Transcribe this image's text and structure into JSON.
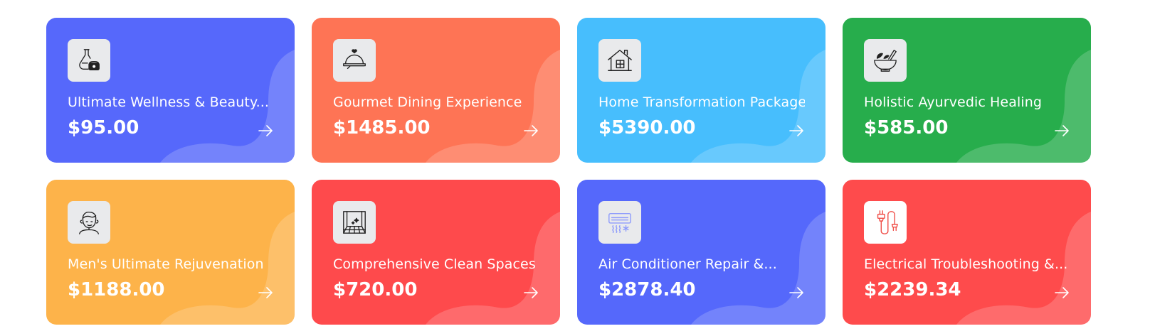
{
  "cards": [
    {
      "title": "Ultimate Wellness & Beauty...",
      "price": "$95.00",
      "color": "#5668fb",
      "icon": "spa-flask-icon"
    },
    {
      "title": "Gourmet Dining Experience",
      "price": "$1485.00",
      "color": "#fe7455",
      "icon": "serving-cloche-icon"
    },
    {
      "title": "Home Transformation Package",
      "price": "$5390.00",
      "color": "#47befd",
      "icon": "house-icon"
    },
    {
      "title": "Holistic Ayurvedic Healing",
      "price": "$585.00",
      "color": "#27ad4c",
      "icon": "mortar-pestle-icon"
    },
    {
      "title": "Men's Ultimate Rejuvenation",
      "price": "$1188.00",
      "color": "#fdb34a",
      "icon": "man-face-icon"
    },
    {
      "title": "Comprehensive Clean Spaces",
      "price": "$720.00",
      "color": "#fe4a4c",
      "icon": "clean-floor-icon"
    },
    {
      "title": "Air Conditioner Repair &...",
      "price": "$2878.40",
      "color": "#5568fb",
      "icon": "air-conditioner-icon"
    },
    {
      "title": "Electrical Troubleshooting &...",
      "price": "$2239.34",
      "color": "#fe4b4c",
      "icon": "electric-cable-icon"
    }
  ]
}
